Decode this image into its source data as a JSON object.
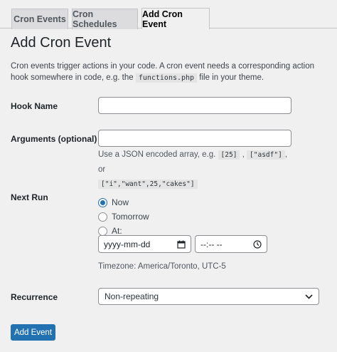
{
  "tabs": [
    {
      "label": "Cron Events",
      "active": false
    },
    {
      "label": "Cron Schedules",
      "active": false
    },
    {
      "label": "Add Cron Event",
      "active": true
    }
  ],
  "title": "Add Cron Event",
  "description": {
    "text_before": "Cron events trigger actions in your code. A cron event needs a corresponding action hook somewhere in code, e.g. the ",
    "code": "functions.php",
    "text_after": " file in your theme."
  },
  "hook_name": {
    "label": "Hook Name",
    "value": ""
  },
  "arguments": {
    "label": "Arguments (optional)",
    "value": "",
    "help_prefix": "Use a JSON encoded array, e.g. ",
    "example_1": "[25]",
    "sep_1": ",",
    "example_2": "[\"asdf\"]",
    "sep_2": ", or",
    "example_3": "[\"i\",\"want\",25,\"cakes\"]"
  },
  "next_run": {
    "label": "Next Run",
    "options": [
      {
        "label": "Now",
        "checked": true
      },
      {
        "label": "Tomorrow",
        "checked": false
      },
      {
        "label": "At:",
        "checked": false
      }
    ],
    "date_placeholder": "yyyy-mm-dd",
    "time_placeholder": "--:-- --",
    "timezone": "Timezone: America/Toronto, UTC-5"
  },
  "recurrence": {
    "label": "Recurrence",
    "selected": "Non-repeating"
  },
  "submit_label": "Add Event",
  "colors": {
    "accent": "#2271b1",
    "background": "#f0f0f1"
  },
  "icons": {
    "calendar": "calendar-icon",
    "clock": "clock-icon",
    "chevron": "chevron-down-icon"
  }
}
